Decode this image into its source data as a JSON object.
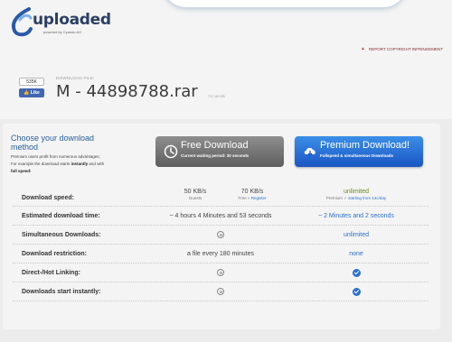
{
  "header": {
    "logo_text": "uploaded",
    "logo_sub": "powered by Cyando AG",
    "report_link": "REPORT COPYRIGHT INFRINGEMENT"
  },
  "social": {
    "like_count": "535K",
    "like_label": "Like"
  },
  "file": {
    "label": "DOWNLOAD FILE:",
    "name": "M - 44898788.rar",
    "size": "717,40 KB"
  },
  "choose": {
    "title": "Choose your download method",
    "desc_1": "Premium users profit from numerous advantages;",
    "desc_2": "For example the download starts",
    "desc_bold": "instantly",
    "desc_3": "and with",
    "desc_4": "full speed",
    "desc_5": "!"
  },
  "buttons": {
    "free_main": "Free Download",
    "free_sub": "Current waiting period: 30 seconds",
    "premium_main": "Premium Download!",
    "premium_sub": "Fullspeed & simultaneous Downloads"
  },
  "table": {
    "rows": [
      {
        "label": "Download speed:"
      },
      {
        "label": "Estimated download time:",
        "free": "~ 4 hours 4 Minutes and 53 seconds",
        "premium": "~ 2 Minutes and 2 seconds"
      },
      {
        "label": "Simultaneous Downloads:",
        "premium": "unlimited"
      },
      {
        "label": "Download restriction:",
        "free": "a file every 180 minutes",
        "premium": "none"
      },
      {
        "label": "Direct-/Hot Linking:"
      },
      {
        "label": "Downloads start instantly:"
      }
    ],
    "speed": {
      "guest_value": "50 KB/s",
      "guest_note": "Guests",
      "free_value": "70 KB/s",
      "free_note": "Free »",
      "free_register": "Register",
      "premium_value": "unlimited",
      "premium_note": "Premium",
      "premium_note_link": "starting from 14c/day"
    }
  },
  "colors": {
    "accent": "#2a6fd0",
    "premium_button": "#1a56c4",
    "free_button": "#6e6e6e",
    "unlimited_green": "#6a8a1e"
  }
}
